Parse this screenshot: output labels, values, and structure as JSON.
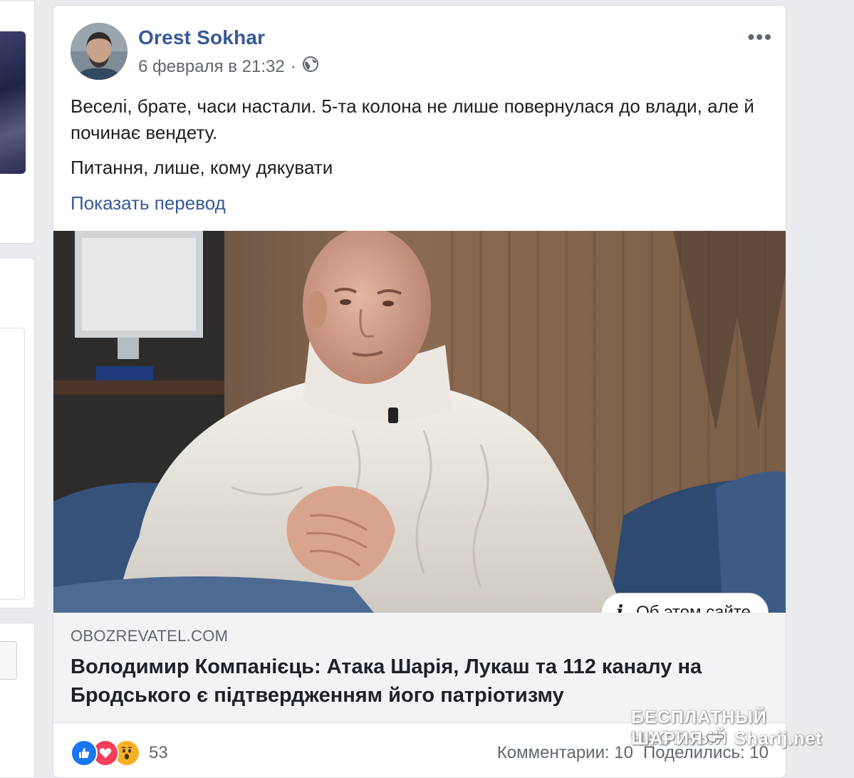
{
  "post": {
    "author": "Orest Sokhar",
    "timestamp": "6 февраля в 21:32",
    "separator": "·",
    "privacy_icon": "globe-icon",
    "more_label": "•••",
    "text_paragraphs": [
      "Веселі, брате, часи настали. 5-та колона не лише повернулася до влади, але й починає вендету.",
      "Питання, лише, кому дякувати"
    ],
    "translate_link": "Показать перевод"
  },
  "link_preview": {
    "about_label": "Об этом сайте",
    "about_icon": "info-icon",
    "domain": "OBOZREVATEL.COM",
    "headline": "Володимир Компанієць: Атака Шарія, Лукаш та 112 каналу на Бродського є підтвердженням його патріотизму"
  },
  "footer": {
    "reaction_icons": [
      "like-icon",
      "love-icon",
      "wow-icon"
    ],
    "reaction_count": "53",
    "comments": "Комментарии: 10",
    "shares": "Поделились: 10"
  },
  "watermark": {
    "line1": "БЕСПЛАТНЫЙ ЧАСТНЫЙ",
    "line2_left": "ШАРИЯ",
    "line2_right": "Sharij.net"
  },
  "colors": {
    "link_blue": "#385898",
    "like_blue": "#1877f2",
    "love_red": "#f33e58",
    "wow_yellow": "#f7b125",
    "page_bg": "#e9ebee"
  }
}
